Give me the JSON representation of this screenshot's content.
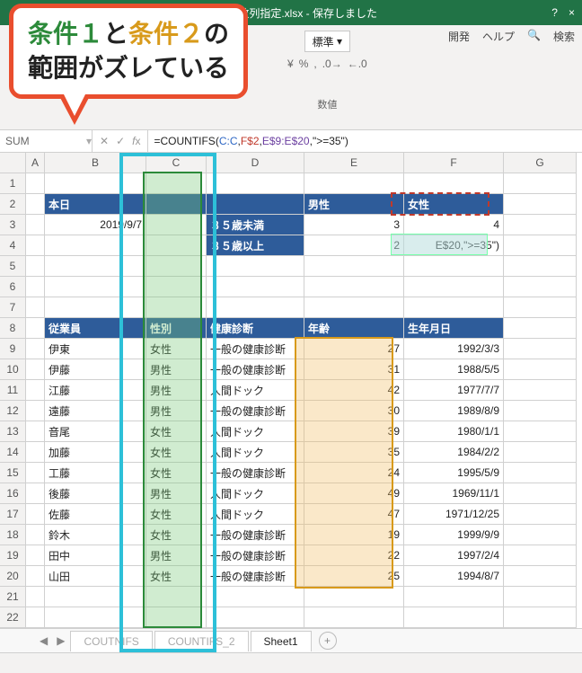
{
  "titlebar": {
    "filename": "IFS_複数列指定.xlsx - 保存しました"
  },
  "ribbon": {
    "tabs": [
      "開発",
      "ヘルプ",
      "検索"
    ],
    "number_format": "標準",
    "group_label": "数値"
  },
  "callout": {
    "part1": "条件１",
    "part2": "と",
    "part3": "条件２",
    "part4": "の",
    "line2": "範囲がズレている"
  },
  "fx": {
    "namebox": "SUM",
    "formula_parts": {
      "eq": "=",
      "fn": "COUNTIFS",
      "open": "(",
      "r1": "C:C",
      "c1": ",",
      "r2": "F$2",
      "c2": ",",
      "r3": "E$9:E$20",
      "c3": ",",
      "lit": "\">=35\"",
      "close": ")"
    }
  },
  "cols": [
    "A",
    "B",
    "C",
    "D",
    "E",
    "F",
    "G"
  ],
  "headers_top": {
    "b2": "本日",
    "e2": "男性",
    "f2": "女性",
    "b3": "2019/9/7",
    "d3": "３５歳未満",
    "e3": "3",
    "f3": "4",
    "d4": "３５歳以上",
    "e4": "2",
    "f4": "E$20,\">=35\")"
  },
  "table_headers": {
    "b": "従業員",
    "c": "性別",
    "d": "健康診断",
    "e": "年齢",
    "f": "生年月日"
  },
  "rows": [
    {
      "n": "伊東",
      "g": "女性",
      "d": "一般の健康診断",
      "a": "27",
      "dob": "1992/3/3"
    },
    {
      "n": "伊藤",
      "g": "男性",
      "d": "一般の健康診断",
      "a": "31",
      "dob": "1988/5/5"
    },
    {
      "n": "江藤",
      "g": "男性",
      "d": "人間ドック",
      "a": "42",
      "dob": "1977/7/7"
    },
    {
      "n": "遠藤",
      "g": "男性",
      "d": "一般の健康診断",
      "a": "30",
      "dob": "1989/8/9"
    },
    {
      "n": "音尾",
      "g": "女性",
      "d": "人間ドック",
      "a": "39",
      "dob": "1980/1/1"
    },
    {
      "n": "加藤",
      "g": "女性",
      "d": "人間ドック",
      "a": "35",
      "dob": "1984/2/2"
    },
    {
      "n": "工藤",
      "g": "女性",
      "d": "一般の健康診断",
      "a": "24",
      "dob": "1995/5/9"
    },
    {
      "n": "後藤",
      "g": "男性",
      "d": "人間ドック",
      "a": "49",
      "dob": "1969/11/1"
    },
    {
      "n": "佐藤",
      "g": "女性",
      "d": "人間ドック",
      "a": "47",
      "dob": "1971/12/25"
    },
    {
      "n": "鈴木",
      "g": "女性",
      "d": "一般の健康診断",
      "a": "19",
      "dob": "1999/9/9"
    },
    {
      "n": "田中",
      "g": "男性",
      "d": "一般の健康診断",
      "a": "22",
      "dob": "1997/2/4"
    },
    {
      "n": "山田",
      "g": "女性",
      "d": "一般の健康診断",
      "a": "25",
      "dob": "1994/8/7"
    }
  ],
  "sheets": {
    "s1": "COUTNIFS",
    "s2": "COUNTIFS_2",
    "s3": "Sheet1"
  }
}
